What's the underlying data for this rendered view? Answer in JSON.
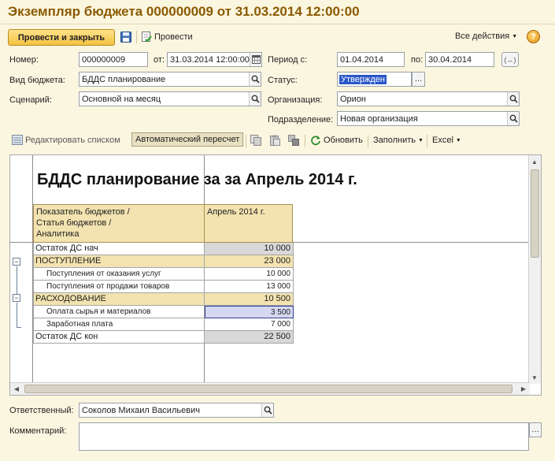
{
  "window": {
    "title": "Экземпляр бюджета 000000009 от 31.03.2014 12:00:00"
  },
  "toolbar": {
    "post_close": "Провести и закрыть",
    "post": "Провести",
    "all_actions": "Все действия",
    "help": "?"
  },
  "form": {
    "number_label": "Номер:",
    "number_value": "000000009",
    "from_label": "от:",
    "from_value": "31.03.2014 12:00:00",
    "period_label": "Период с:",
    "period_from": "01.04.2014",
    "period_to_label": "по:",
    "period_to": "30.04.2014",
    "period_btn": "(↔)",
    "budget_type_label": "Вид бюджета:",
    "budget_type_value": "БДДС планирование",
    "status_label": "Статус:",
    "status_value": "Утвержден",
    "scenario_label": "Сценарий:",
    "scenario_value": "Основной на месяц",
    "org_label": "Организация:",
    "org_value": "Орион",
    "subdivision_label": "Подразделение:",
    "subdivision_value": "Новая организация"
  },
  "table_toolbar": {
    "edit_list": "Редактировать списком",
    "auto_recalc": "Автоматический пересчет",
    "refresh": "Обновить",
    "fill": "Заполнить",
    "excel": "Excel"
  },
  "report": {
    "title": "БДДС планирование за за Апрель 2014 г.",
    "col_header": "Показатель бюджетов /\nСтатья бюджетов /\nАналитика",
    "period_header": "Апрель 2014 г.",
    "rows": [
      {
        "name": "Остаток ДС нач",
        "value": "10 000"
      },
      {
        "name": "ПОСТУПЛЕНИЕ",
        "value": "23 000"
      },
      {
        "name": "Поступления от оказания услуг",
        "value": "10 000"
      },
      {
        "name": "Поступления от продажи товаров",
        "value": "13 000"
      },
      {
        "name": "РАСХОДОВАНИЕ",
        "value": "10 500"
      },
      {
        "name": "Оплата сырья и материалов",
        "value": "3 500"
      },
      {
        "name": "Заработная плата",
        "value": "7 000"
      },
      {
        "name": "Остаток ДС кон",
        "value": "22 500"
      }
    ]
  },
  "footer": {
    "responsible_label": "Ответственный:",
    "responsible_value": "Соколов Михаил Васильевич",
    "comment_label": "Комментарий:",
    "comment_value": ""
  },
  "icons": {
    "search": "magnifier-icon",
    "save": "floppy-icon",
    "post": "document-post-icon",
    "calendar": "calendar-icon",
    "refresh": "refresh-icon"
  },
  "colors": {
    "title": "#8a5a00",
    "primary_button": "#f3c242",
    "group_row": "#f3e3b0",
    "background": "#fbf6e0"
  }
}
